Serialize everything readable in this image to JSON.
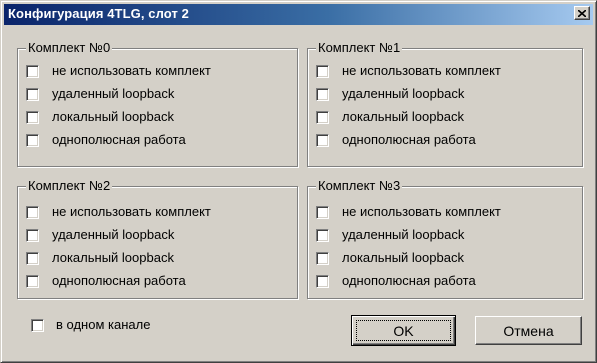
{
  "window": {
    "title": "Конфигурация 4TLG, слот 2"
  },
  "groups": [
    {
      "label": "Комплект №0",
      "options": [
        "не использовать комплект",
        "удаленный loopback",
        "локальный loopback",
        "однополюсная работа"
      ]
    },
    {
      "label": "Комплект №1",
      "options": [
        "не использовать комплект",
        "удаленный loopback",
        "локальный loopback",
        "однополюсная работа"
      ]
    },
    {
      "label": "Комплект №2",
      "options": [
        "не использовать комплект",
        "удаленный loopback",
        "локальный loopback",
        "однополюсная работа"
      ]
    },
    {
      "label": "Комплект №3",
      "options": [
        "не использовать комплект",
        "удаленный loopback",
        "локальный loopback",
        "однополюсная работа"
      ]
    }
  ],
  "single_channel": {
    "label": "в одном канале",
    "checked": false
  },
  "buttons": {
    "ok": "OK",
    "cancel": "Отмена"
  }
}
